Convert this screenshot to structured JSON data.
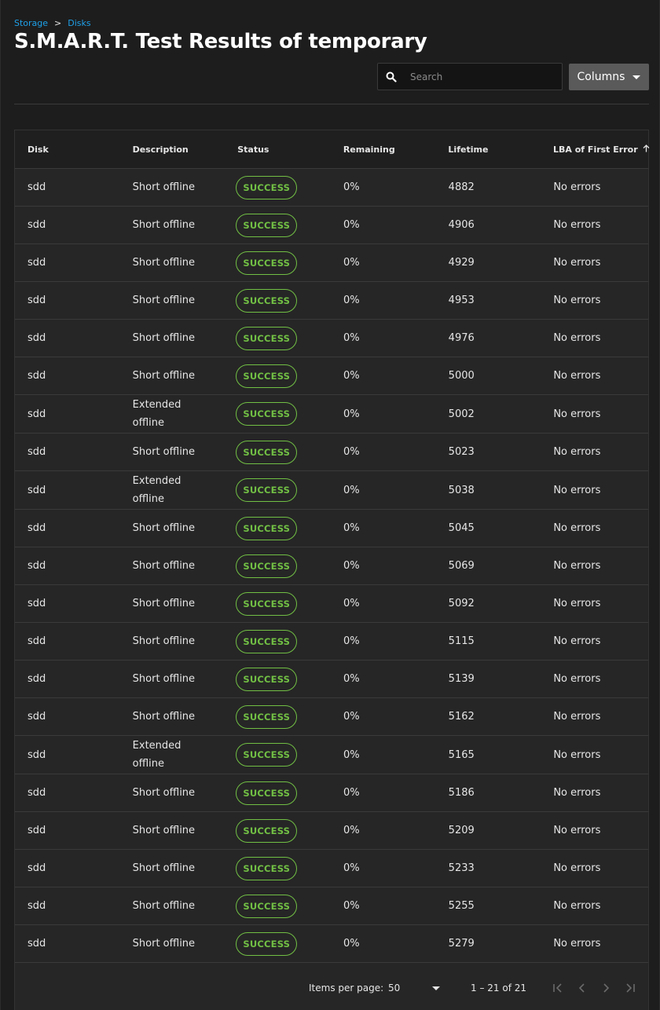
{
  "breadcrumb": {
    "storage": "Storage",
    "separator": ">",
    "disks": "Disks"
  },
  "title": "S.M.A.R.T. Test Results of temporary",
  "search": {
    "placeholder": "Search",
    "value": ""
  },
  "columns_button": {
    "label": "Columns"
  },
  "table": {
    "headers": {
      "disk": "Disk",
      "description": "Description",
      "status": "Status",
      "remaining": "Remaining",
      "lifetime": "Lifetime",
      "lba": "LBA of First Error"
    },
    "sort_icon": "arrow-up-icon",
    "rows": [
      {
        "disk": "sdd",
        "description": "Short offline",
        "status": "SUCCESS",
        "remaining": "0%",
        "lifetime": "4882",
        "lba": "No errors"
      },
      {
        "disk": "sdd",
        "description": "Short offline",
        "status": "SUCCESS",
        "remaining": "0%",
        "lifetime": "4906",
        "lba": "No errors"
      },
      {
        "disk": "sdd",
        "description": "Short offline",
        "status": "SUCCESS",
        "remaining": "0%",
        "lifetime": "4929",
        "lba": "No errors"
      },
      {
        "disk": "sdd",
        "description": "Short offline",
        "status": "SUCCESS",
        "remaining": "0%",
        "lifetime": "4953",
        "lba": "No errors"
      },
      {
        "disk": "sdd",
        "description": "Short offline",
        "status": "SUCCESS",
        "remaining": "0%",
        "lifetime": "4976",
        "lba": "No errors"
      },
      {
        "disk": "sdd",
        "description": "Short offline",
        "status": "SUCCESS",
        "remaining": "0%",
        "lifetime": "5000",
        "lba": "No errors"
      },
      {
        "disk": "sdd",
        "description": "Extended offline",
        "status": "SUCCESS",
        "remaining": "0%",
        "lifetime": "5002",
        "lba": "No errors"
      },
      {
        "disk": "sdd",
        "description": "Short offline",
        "status": "SUCCESS",
        "remaining": "0%",
        "lifetime": "5023",
        "lba": "No errors"
      },
      {
        "disk": "sdd",
        "description": "Extended offline",
        "status": "SUCCESS",
        "remaining": "0%",
        "lifetime": "5038",
        "lba": "No errors"
      },
      {
        "disk": "sdd",
        "description": "Short offline",
        "status": "SUCCESS",
        "remaining": "0%",
        "lifetime": "5045",
        "lba": "No errors"
      },
      {
        "disk": "sdd",
        "description": "Short offline",
        "status": "SUCCESS",
        "remaining": "0%",
        "lifetime": "5069",
        "lba": "No errors"
      },
      {
        "disk": "sdd",
        "description": "Short offline",
        "status": "SUCCESS",
        "remaining": "0%",
        "lifetime": "5092",
        "lba": "No errors"
      },
      {
        "disk": "sdd",
        "description": "Short offline",
        "status": "SUCCESS",
        "remaining": "0%",
        "lifetime": "5115",
        "lba": "No errors"
      },
      {
        "disk": "sdd",
        "description": "Short offline",
        "status": "SUCCESS",
        "remaining": "0%",
        "lifetime": "5139",
        "lba": "No errors"
      },
      {
        "disk": "sdd",
        "description": "Short offline",
        "status": "SUCCESS",
        "remaining": "0%",
        "lifetime": "5162",
        "lba": "No errors"
      },
      {
        "disk": "sdd",
        "description": "Extended offline",
        "status": "SUCCESS",
        "remaining": "0%",
        "lifetime": "5165",
        "lba": "No errors"
      },
      {
        "disk": "sdd",
        "description": "Short offline",
        "status": "SUCCESS",
        "remaining": "0%",
        "lifetime": "5186",
        "lba": "No errors"
      },
      {
        "disk": "sdd",
        "description": "Short offline",
        "status": "SUCCESS",
        "remaining": "0%",
        "lifetime": "5209",
        "lba": "No errors"
      },
      {
        "disk": "sdd",
        "description": "Short offline",
        "status": "SUCCESS",
        "remaining": "0%",
        "lifetime": "5233",
        "lba": "No errors"
      },
      {
        "disk": "sdd",
        "description": "Short offline",
        "status": "SUCCESS",
        "remaining": "0%",
        "lifetime": "5255",
        "lba": "No errors"
      },
      {
        "disk": "sdd",
        "description": "Short offline",
        "status": "SUCCESS",
        "remaining": "0%",
        "lifetime": "5279",
        "lba": "No errors"
      }
    ]
  },
  "paginator": {
    "items_per_page_label": "Items per page:",
    "items_per_page_value": "50",
    "range_label": "1 – 21 of 21"
  },
  "colors": {
    "accent_link": "#1ea0e8",
    "success": "#71bf44",
    "background": "#1d1d1d",
    "table_bg": "#262626",
    "button_bg": "#5a5a5a"
  }
}
